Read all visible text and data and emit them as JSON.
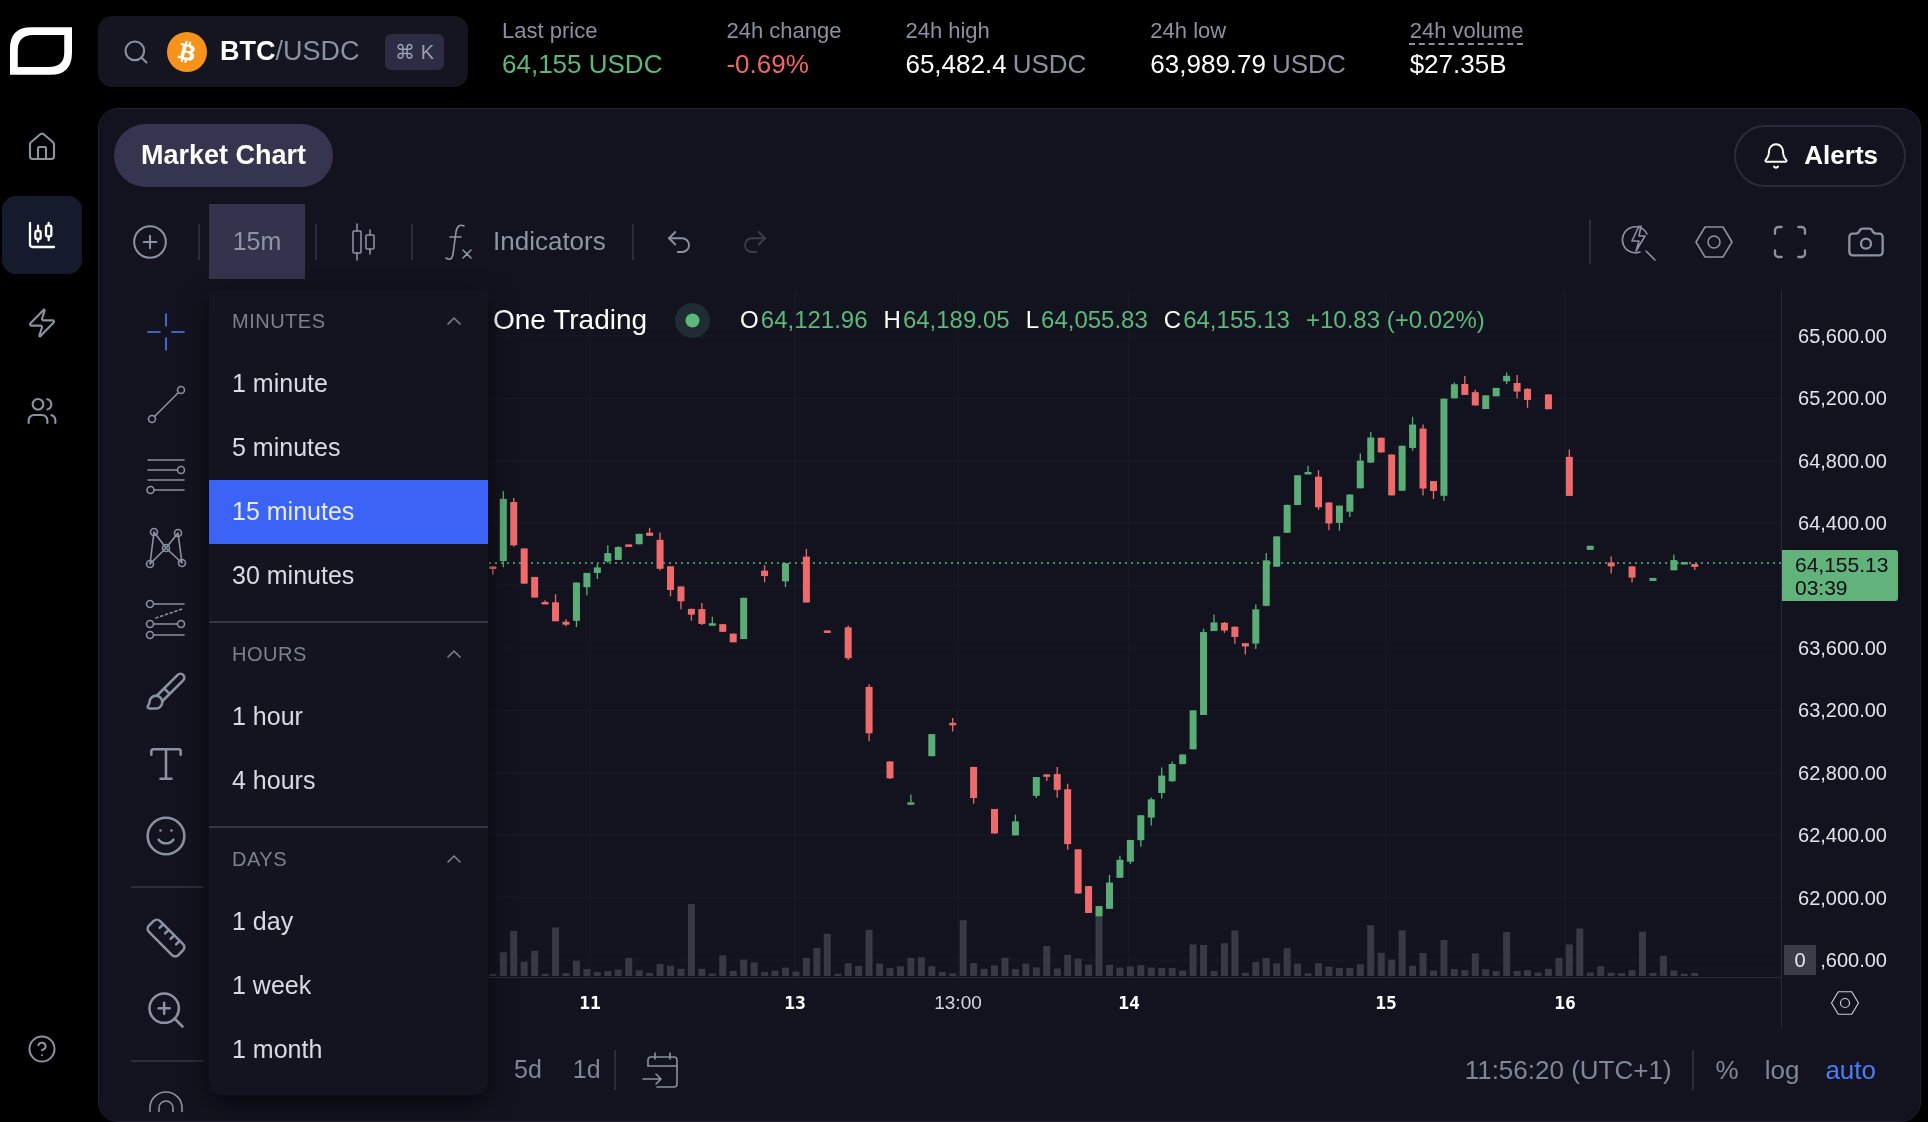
{
  "nav_items": [
    {
      "selected": false
    },
    {
      "selected": true
    },
    {
      "selected": false
    },
    {
      "selected": false
    }
  ],
  "search": {
    "base": "BTC",
    "quote": "/USDC",
    "shortcut": "⌘ K"
  },
  "stats": [
    {
      "label": "Last price",
      "value": "64,155 USDC",
      "color": "#5cb97a",
      "dotted_underline": false
    },
    {
      "label": "24h change",
      "value": "-0.69%",
      "color": "#f2666a",
      "dotted_underline": false
    },
    {
      "label": "24h high",
      "value": "65,482.4",
      "unit": "USDC",
      "color": "#ffffff",
      "dotted_underline": false
    },
    {
      "label": "24h low",
      "value": "63,989.79",
      "unit": "USDC",
      "color": "#ffffff",
      "dotted_underline": false
    },
    {
      "label": "24h volume",
      "value": "$27.35B",
      "color": "#ffffff",
      "dotted_underline": true
    }
  ],
  "panel": {
    "title": "Market Chart",
    "alerts": "Alerts"
  },
  "toolbar": {
    "interval": {
      "label": "15m",
      "open": true
    },
    "indicators": "Indicators",
    "undo": {
      "disabled": false
    },
    "redo": {
      "disabled": true
    }
  },
  "tool_groups": [
    {
      "tools": [
        {
          "selected": true
        },
        {
          "selected": false
        },
        {
          "selected": false
        },
        {
          "selected": false
        },
        {
          "selected": false
        },
        {
          "selected": false
        },
        {
          "selected": false
        },
        {
          "selected": false
        }
      ]
    },
    {
      "tools": [
        {
          "selected": false
        },
        {
          "selected": false
        }
      ]
    },
    {
      "tools": [
        {
          "selected": false
        }
      ]
    }
  ],
  "interval_menu": {
    "sections": [
      {
        "title": "MINUTES",
        "expanded": true,
        "items": [
          {
            "label": "1 minute",
            "selected": false
          },
          {
            "label": "5 minutes",
            "selected": false
          },
          {
            "label": "15 minutes",
            "selected": true
          },
          {
            "label": "30 minutes",
            "selected": false
          }
        ]
      },
      {
        "title": "HOURS",
        "expanded": true,
        "items": [
          {
            "label": "1 hour",
            "selected": false
          },
          {
            "label": "4 hours",
            "selected": false
          }
        ]
      },
      {
        "title": "DAYS",
        "expanded": true,
        "items": [
          {
            "label": "1 day",
            "selected": false
          },
          {
            "label": "1 week",
            "selected": false
          },
          {
            "label": "1 month",
            "selected": false
          }
        ]
      }
    ]
  },
  "legend": {
    "symbol": "One Trading",
    "live": true,
    "rising": true,
    "ohlc": [
      {
        "label": "O",
        "value": "64,121.96"
      },
      {
        "label": "H",
        "value": "64,189.05"
      },
      {
        "label": "L",
        "value": "64,055.83"
      },
      {
        "label": "C",
        "value": "64,155.13"
      }
    ],
    "change": "+10.83 (+0.02%)"
  },
  "price_axis": {
    "labels": [
      "65,600.00",
      "65,200.00",
      "64,800.00",
      "64,400.00",
      "63,600.00",
      "63,200.00",
      "62,800.00",
      "62,400.00",
      "62,000.00",
      ",600.00"
    ],
    "current_price": "64,155.13",
    "countdown": "03:39",
    "volume_label": "0"
  },
  "time_axis": {
    "labels": [
      {
        "text": "11",
        "kind": "day"
      },
      {
        "text": "13",
        "kind": "day"
      },
      {
        "text": "13:00",
        "kind": "time"
      },
      {
        "text": "14",
        "kind": "day"
      },
      {
        "text": "15",
        "kind": "day"
      },
      {
        "text": "16",
        "kind": "day"
      }
    ]
  },
  "bottom_bar": {
    "ranges": [
      {
        "label": "5d",
        "selected": false
      },
      {
        "label": "1d",
        "selected": false
      }
    ],
    "clock": "11:56:20 (UTC+1)",
    "scale_buttons": [
      {
        "label": "%",
        "selected": false
      },
      {
        "label": "log",
        "selected": false
      },
      {
        "label": "auto",
        "selected": true
      }
    ]
  }
}
